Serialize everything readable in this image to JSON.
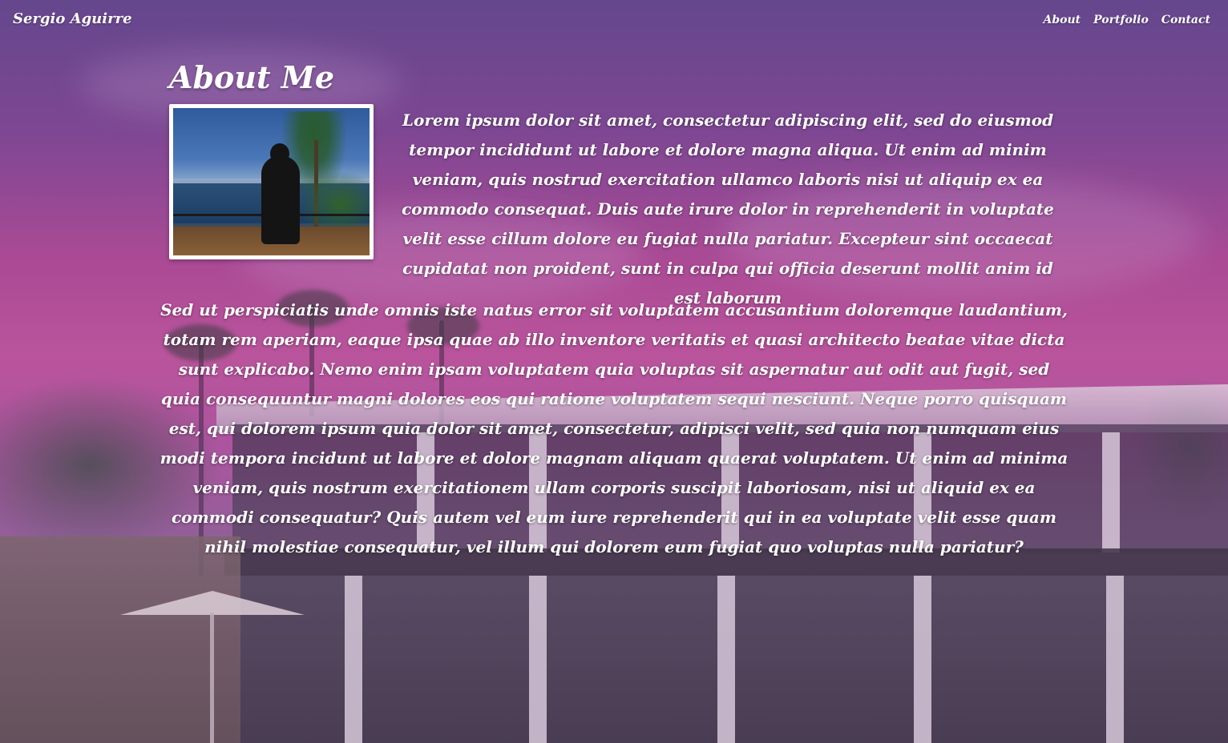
{
  "header": {
    "site_title": "Sergio Aguirre",
    "nav": [
      {
        "label": "About"
      },
      {
        "label": "Portfolio"
      },
      {
        "label": "Contact"
      }
    ]
  },
  "main": {
    "heading": "About Me",
    "intro": "Lorem ipsum dolor sit amet, consectetur adipiscing elit, sed do eiusmod tempor incididunt ut labore et dolore magna aliqua. Ut enim ad minim veniam, quis nostrud exercitation ullamco laboris nisi ut aliquip ex ea commodo consequat. Duis aute irure dolor in reprehenderit in voluptate velit esse cillum dolore eu fugiat nulla pariatur. Excepteur sint occaecat cupidatat non proident, sunt in culpa qui officia deserunt mollit anim id est laborum",
    "body": "Sed ut perspiciatis unde omnis iste natus error sit voluptatem accusantium doloremque laudantium, totam rem aperiam, eaque ipsa quae ab illo inventore veritatis et quasi architecto beatae vitae dicta sunt explicabo. Nemo enim ipsam voluptatem quia voluptas sit aspernatur aut odit aut fugit, sed quia consequuntur magni dolores eos qui ratione voluptatem sequi nesciunt. Neque porro quisquam est, qui dolorem ipsum quia dolor sit amet, consectetur, adipisci velit, sed quia non numquam eius modi tempora incidunt ut labore et dolore magnam aliquam quaerat voluptatem. Ut enim ad minima veniam, quis nostrum exercitationem ullam corporis suscipit laboriosam, nisi ut aliquid ex ea commodi consequatur? Quis autem vel eum iure reprehenderit qui in ea voluptate velit esse quam nihil molestiae consequatur, vel illum qui dolorem eum fugiat quo voluptas nulla pariatur?"
  },
  "colors": {
    "text": "#ffffff",
    "sky_top": "#5a4a8e",
    "sky_mid": "#c25aa0",
    "photo_border": "#ffffff"
  }
}
